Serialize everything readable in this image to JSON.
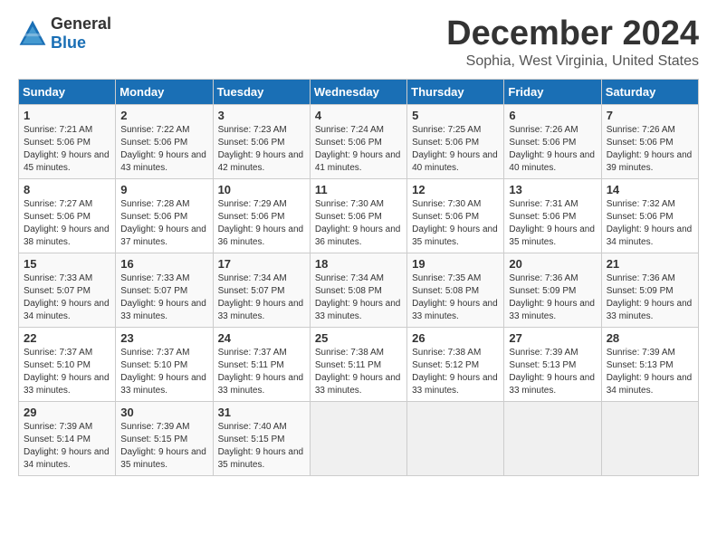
{
  "header": {
    "logo": {
      "general": "General",
      "blue": "Blue"
    },
    "title": "December 2024",
    "location": "Sophia, West Virginia, United States"
  },
  "calendar": {
    "columns": [
      "Sunday",
      "Monday",
      "Tuesday",
      "Wednesday",
      "Thursday",
      "Friday",
      "Saturday"
    ],
    "rows": [
      [
        {
          "day": "1",
          "sunrise": "Sunrise: 7:21 AM",
          "sunset": "Sunset: 5:06 PM",
          "daylight": "Daylight: 9 hours and 45 minutes."
        },
        {
          "day": "2",
          "sunrise": "Sunrise: 7:22 AM",
          "sunset": "Sunset: 5:06 PM",
          "daylight": "Daylight: 9 hours and 43 minutes."
        },
        {
          "day": "3",
          "sunrise": "Sunrise: 7:23 AM",
          "sunset": "Sunset: 5:06 PM",
          "daylight": "Daylight: 9 hours and 42 minutes."
        },
        {
          "day": "4",
          "sunrise": "Sunrise: 7:24 AM",
          "sunset": "Sunset: 5:06 PM",
          "daylight": "Daylight: 9 hours and 41 minutes."
        },
        {
          "day": "5",
          "sunrise": "Sunrise: 7:25 AM",
          "sunset": "Sunset: 5:06 PM",
          "daylight": "Daylight: 9 hours and 40 minutes."
        },
        {
          "day": "6",
          "sunrise": "Sunrise: 7:26 AM",
          "sunset": "Sunset: 5:06 PM",
          "daylight": "Daylight: 9 hours and 40 minutes."
        },
        {
          "day": "7",
          "sunrise": "Sunrise: 7:26 AM",
          "sunset": "Sunset: 5:06 PM",
          "daylight": "Daylight: 9 hours and 39 minutes."
        }
      ],
      [
        {
          "day": "8",
          "sunrise": "Sunrise: 7:27 AM",
          "sunset": "Sunset: 5:06 PM",
          "daylight": "Daylight: 9 hours and 38 minutes."
        },
        {
          "day": "9",
          "sunrise": "Sunrise: 7:28 AM",
          "sunset": "Sunset: 5:06 PM",
          "daylight": "Daylight: 9 hours and 37 minutes."
        },
        {
          "day": "10",
          "sunrise": "Sunrise: 7:29 AM",
          "sunset": "Sunset: 5:06 PM",
          "daylight": "Daylight: 9 hours and 36 minutes."
        },
        {
          "day": "11",
          "sunrise": "Sunrise: 7:30 AM",
          "sunset": "Sunset: 5:06 PM",
          "daylight": "Daylight: 9 hours and 36 minutes."
        },
        {
          "day": "12",
          "sunrise": "Sunrise: 7:30 AM",
          "sunset": "Sunset: 5:06 PM",
          "daylight": "Daylight: 9 hours and 35 minutes."
        },
        {
          "day": "13",
          "sunrise": "Sunrise: 7:31 AM",
          "sunset": "Sunset: 5:06 PM",
          "daylight": "Daylight: 9 hours and 35 minutes."
        },
        {
          "day": "14",
          "sunrise": "Sunrise: 7:32 AM",
          "sunset": "Sunset: 5:06 PM",
          "daylight": "Daylight: 9 hours and 34 minutes."
        }
      ],
      [
        {
          "day": "15",
          "sunrise": "Sunrise: 7:33 AM",
          "sunset": "Sunset: 5:07 PM",
          "daylight": "Daylight: 9 hours and 34 minutes."
        },
        {
          "day": "16",
          "sunrise": "Sunrise: 7:33 AM",
          "sunset": "Sunset: 5:07 PM",
          "daylight": "Daylight: 9 hours and 33 minutes."
        },
        {
          "day": "17",
          "sunrise": "Sunrise: 7:34 AM",
          "sunset": "Sunset: 5:07 PM",
          "daylight": "Daylight: 9 hours and 33 minutes."
        },
        {
          "day": "18",
          "sunrise": "Sunrise: 7:34 AM",
          "sunset": "Sunset: 5:08 PM",
          "daylight": "Daylight: 9 hours and 33 minutes."
        },
        {
          "day": "19",
          "sunrise": "Sunrise: 7:35 AM",
          "sunset": "Sunset: 5:08 PM",
          "daylight": "Daylight: 9 hours and 33 minutes."
        },
        {
          "day": "20",
          "sunrise": "Sunrise: 7:36 AM",
          "sunset": "Sunset: 5:09 PM",
          "daylight": "Daylight: 9 hours and 33 minutes."
        },
        {
          "day": "21",
          "sunrise": "Sunrise: 7:36 AM",
          "sunset": "Sunset: 5:09 PM",
          "daylight": "Daylight: 9 hours and 33 minutes."
        }
      ],
      [
        {
          "day": "22",
          "sunrise": "Sunrise: 7:37 AM",
          "sunset": "Sunset: 5:10 PM",
          "daylight": "Daylight: 9 hours and 33 minutes."
        },
        {
          "day": "23",
          "sunrise": "Sunrise: 7:37 AM",
          "sunset": "Sunset: 5:10 PM",
          "daylight": "Daylight: 9 hours and 33 minutes."
        },
        {
          "day": "24",
          "sunrise": "Sunrise: 7:37 AM",
          "sunset": "Sunset: 5:11 PM",
          "daylight": "Daylight: 9 hours and 33 minutes."
        },
        {
          "day": "25",
          "sunrise": "Sunrise: 7:38 AM",
          "sunset": "Sunset: 5:11 PM",
          "daylight": "Daylight: 9 hours and 33 minutes."
        },
        {
          "day": "26",
          "sunrise": "Sunrise: 7:38 AM",
          "sunset": "Sunset: 5:12 PM",
          "daylight": "Daylight: 9 hours and 33 minutes."
        },
        {
          "day": "27",
          "sunrise": "Sunrise: 7:39 AM",
          "sunset": "Sunset: 5:13 PM",
          "daylight": "Daylight: 9 hours and 33 minutes."
        },
        {
          "day": "28",
          "sunrise": "Sunrise: 7:39 AM",
          "sunset": "Sunset: 5:13 PM",
          "daylight": "Daylight: 9 hours and 34 minutes."
        }
      ],
      [
        {
          "day": "29",
          "sunrise": "Sunrise: 7:39 AM",
          "sunset": "Sunset: 5:14 PM",
          "daylight": "Daylight: 9 hours and 34 minutes."
        },
        {
          "day": "30",
          "sunrise": "Sunrise: 7:39 AM",
          "sunset": "Sunset: 5:15 PM",
          "daylight": "Daylight: 9 hours and 35 minutes."
        },
        {
          "day": "31",
          "sunrise": "Sunrise: 7:40 AM",
          "sunset": "Sunset: 5:15 PM",
          "daylight": "Daylight: 9 hours and 35 minutes."
        },
        null,
        null,
        null,
        null
      ]
    ]
  }
}
